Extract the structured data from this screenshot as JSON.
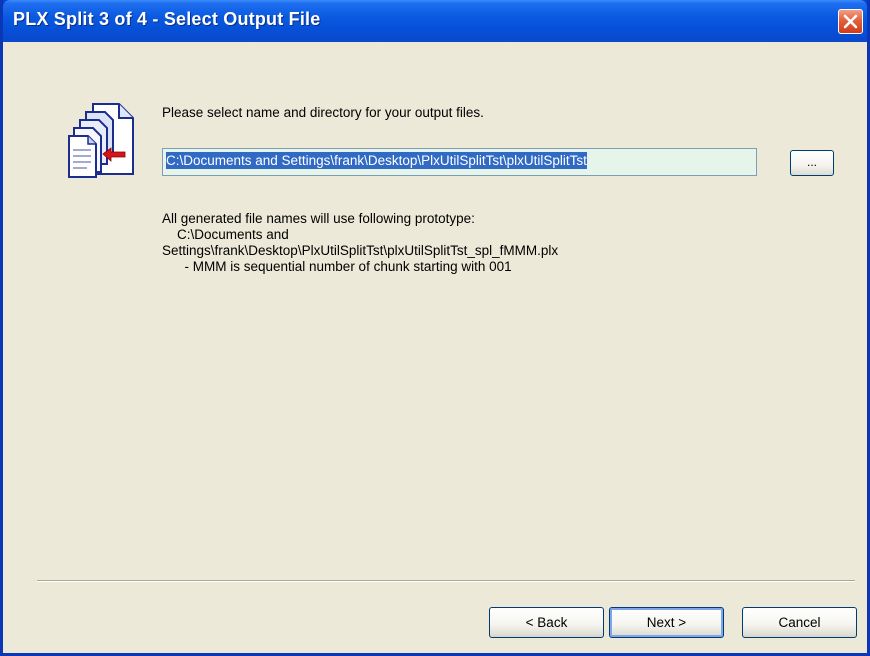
{
  "window": {
    "title": "PLX Split 3 of 4 - Select Output File",
    "close_icon": "close-icon"
  },
  "main": {
    "icon": "document-split-icon",
    "prompt": "Please select name and directory for your output files.",
    "output_path": "C:\\Documents and Settings\\frank\\Desktop\\PlxUtilSplitTst\\plxUtilSplitTst",
    "browse_label": "...",
    "info_line1": "All generated file names will use following prototype:",
    "info_line2": "    C:\\Documents and",
    "info_line3": "Settings\\frank\\Desktop\\PlxUtilSplitTst\\plxUtilSplitTst_spl_fMMM.plx",
    "info_line4": "      - MMM is sequential number of chunk starting with 001"
  },
  "footer": {
    "back_label": "< Back",
    "next_label": "Next >",
    "cancel_label": "Cancel"
  },
  "colors": {
    "titlebar": "#0a5ae0",
    "client_bg": "#ece9d8",
    "selection": "#316ac5",
    "input_bg": "#e6f5ea",
    "close_button": "#e4603a"
  }
}
